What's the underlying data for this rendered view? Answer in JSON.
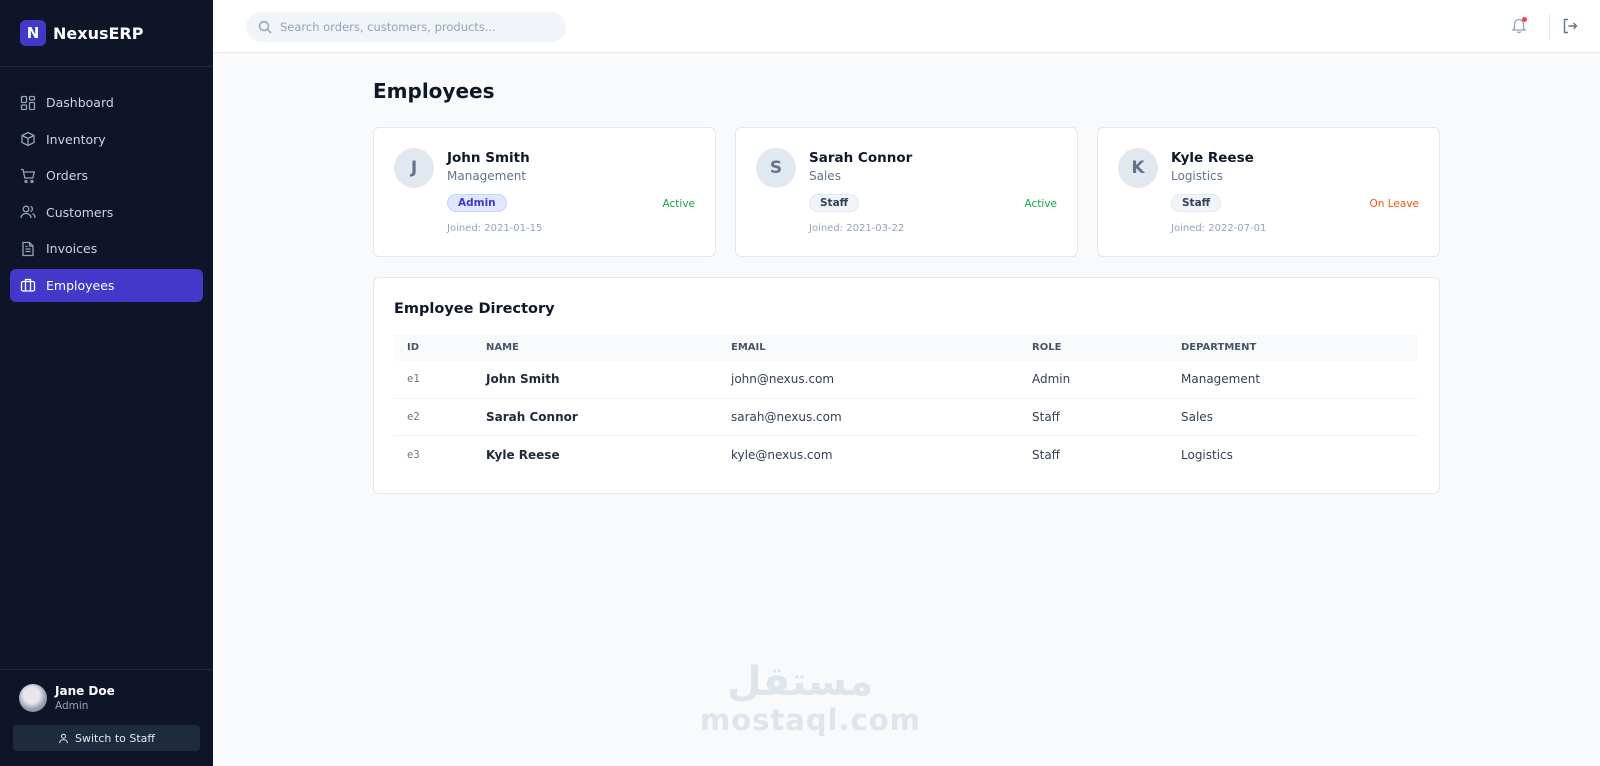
{
  "app": {
    "logo_letter": "N",
    "name": "NexusERP"
  },
  "sidebar": {
    "items": [
      {
        "label": "Dashboard",
        "icon": "grid-icon",
        "active": false
      },
      {
        "label": "Inventory",
        "icon": "box-icon",
        "active": false
      },
      {
        "label": "Orders",
        "icon": "cart-icon",
        "active": false
      },
      {
        "label": "Customers",
        "icon": "users-icon",
        "active": false
      },
      {
        "label": "Invoices",
        "icon": "document-icon",
        "active": false
      },
      {
        "label": "Employees",
        "icon": "briefcase-icon",
        "active": true
      }
    ],
    "user": {
      "name": "Jane Doe",
      "role": "Admin"
    },
    "switch_label": "Switch to Staff"
  },
  "header": {
    "search_placeholder": "Search orders, customers, products..."
  },
  "page": {
    "title": "Employees",
    "cards": [
      {
        "initial": "J",
        "name": "John Smith",
        "department": "Management",
        "role": "Admin",
        "status": "Active",
        "joined": "Joined: 2021-01-15"
      },
      {
        "initial": "S",
        "name": "Sarah Connor",
        "department": "Sales",
        "role": "Staff",
        "status": "Active",
        "joined": "Joined: 2021-03-22"
      },
      {
        "initial": "K",
        "name": "Kyle Reese",
        "department": "Logistics",
        "role": "Staff",
        "status": "On Leave",
        "joined": "Joined: 2022-07-01"
      }
    ],
    "directory": {
      "title": "Employee Directory",
      "columns": [
        "ID",
        "NAME",
        "EMAIL",
        "ROLE",
        "DEPARTMENT"
      ],
      "rows": [
        {
          "id": "e1",
          "name": "John Smith",
          "email": "john@nexus.com",
          "role": "Admin",
          "department": "Management"
        },
        {
          "id": "e2",
          "name": "Sarah Connor",
          "email": "sarah@nexus.com",
          "role": "Staff",
          "department": "Sales"
        },
        {
          "id": "e3",
          "name": "Kyle Reese",
          "email": "kyle@nexus.com",
          "role": "Staff",
          "department": "Logistics"
        }
      ]
    }
  },
  "watermark": {
    "arabic": "مستقل",
    "latin": "mostaql.com"
  },
  "colors": {
    "sidebar_bg": "#0f1429",
    "accent": "#4338ca",
    "active_status": "#16a34a",
    "leave_status": "#ea580c"
  }
}
